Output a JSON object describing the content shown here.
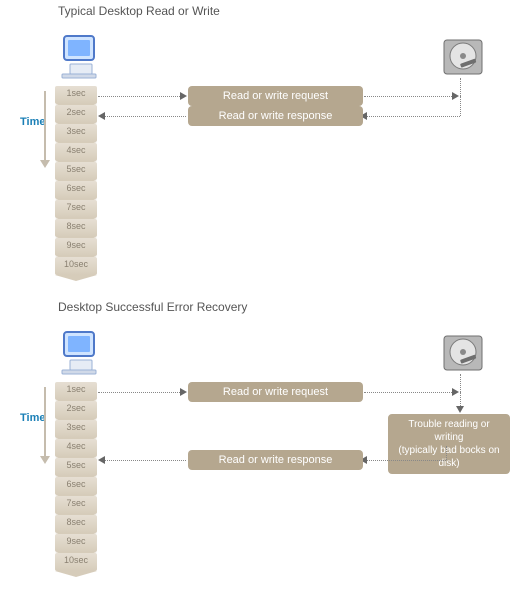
{
  "section1": {
    "title": "Typical Desktop Read or Write",
    "time_label": "Time",
    "ticks": [
      "1sec",
      "2sec",
      "3sec",
      "4sec",
      "5sec",
      "6sec",
      "7sec",
      "8sec",
      "9sec",
      "10sec"
    ],
    "request_label": "Read or write request",
    "response_label": "Read or write response"
  },
  "section2": {
    "title": "Desktop Successful Error Recovery",
    "time_label": "Time",
    "ticks": [
      "1sec",
      "2sec",
      "3sec",
      "4sec",
      "5sec",
      "6sec",
      "7sec",
      "8sec",
      "9sec",
      "10sec"
    ],
    "request_label": "Read or write request",
    "trouble_label": "Trouble reading or writing\n(typically bad bocks on disk)",
    "response_label": "Read or write response"
  },
  "icons": {
    "computer": "computer-icon",
    "disk": "hard-disk-icon"
  }
}
